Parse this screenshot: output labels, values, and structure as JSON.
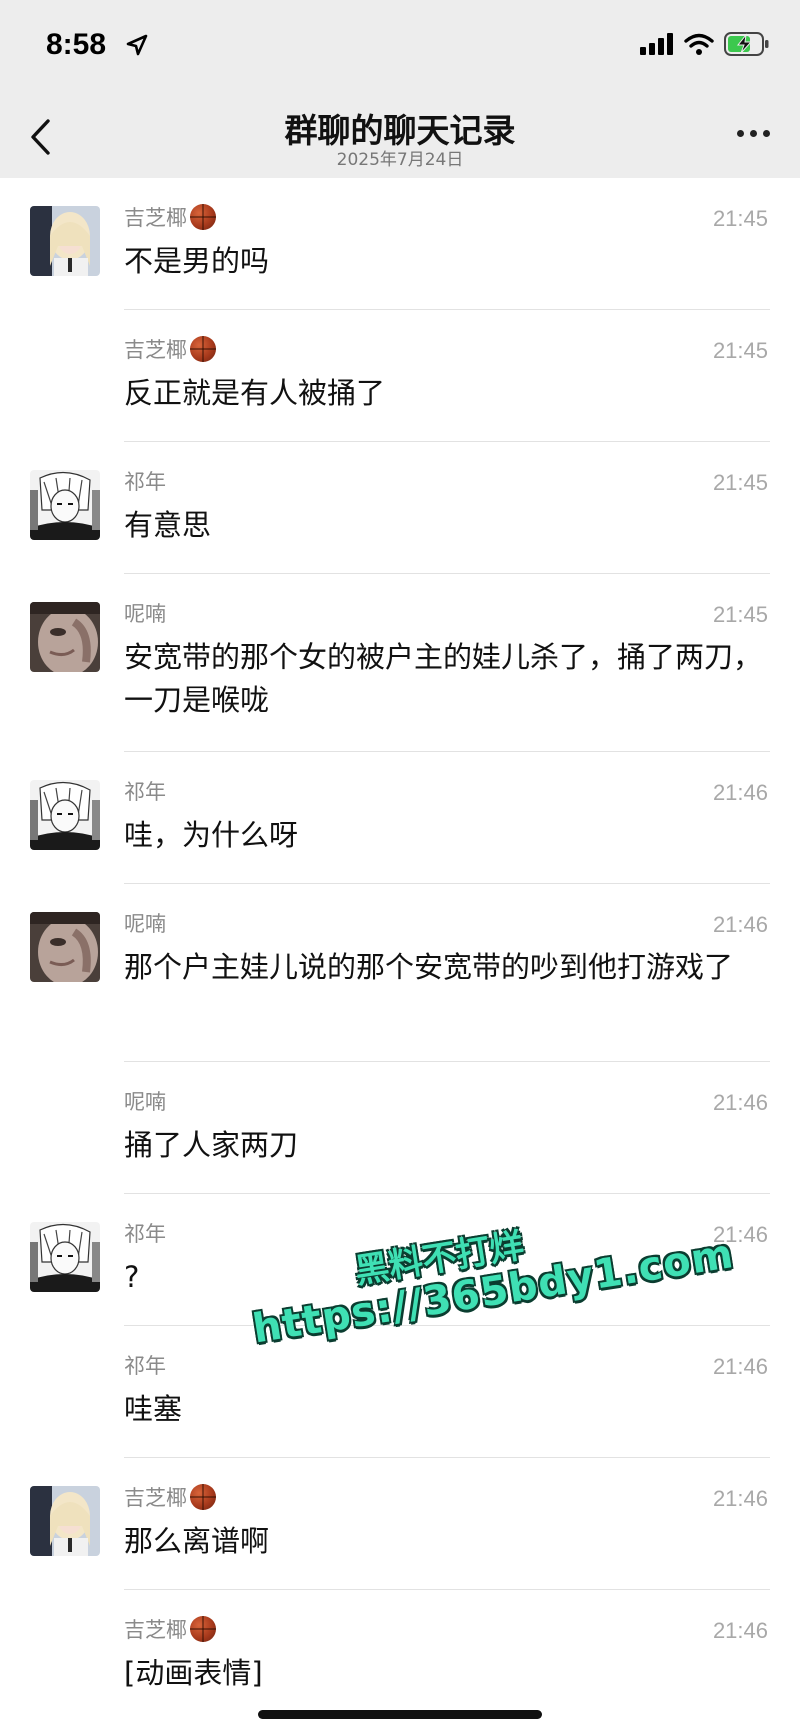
{
  "status_bar": {
    "time": "8:58"
  },
  "header": {
    "title": "群聊的聊天记录",
    "subtitle": "2025年7月24日"
  },
  "messages": [
    {
      "sender": "吉芝椰",
      "time": "21:45",
      "text": "不是男的吗"
    },
    {
      "sender": "吉芝椰",
      "time": "21:45",
      "text": "反正就是有人被捅了"
    },
    {
      "sender": "祁年",
      "time": "21:45",
      "text": "有意思"
    },
    {
      "sender": "呢喃",
      "time": "21:45",
      "text": "安宽带的那个女的被户主的娃儿杀了，捅了两刀，一刀是喉咙"
    },
    {
      "sender": "祁年",
      "time": "21:46",
      "text": "哇，为什么呀"
    },
    {
      "sender": "呢喃",
      "time": "21:46",
      "text": "那个户主娃儿说的那个安宽带的吵到他打游戏了"
    },
    {
      "sender": "呢喃",
      "time": "21:46",
      "text": "捅了人家两刀"
    },
    {
      "sender": "祁年",
      "time": "21:46",
      "text": "?"
    },
    {
      "sender": "祁年",
      "time": "21:46",
      "text": "哇塞"
    },
    {
      "sender": "吉芝椰",
      "time": "21:46",
      "text": "那么离谱啊"
    },
    {
      "sender": "吉芝椰",
      "time": "21:46",
      "text": "[动画表情]"
    }
  ],
  "watermark": {
    "line1": "黑料不打烊",
    "line2": "https://365bdy1.com"
  }
}
